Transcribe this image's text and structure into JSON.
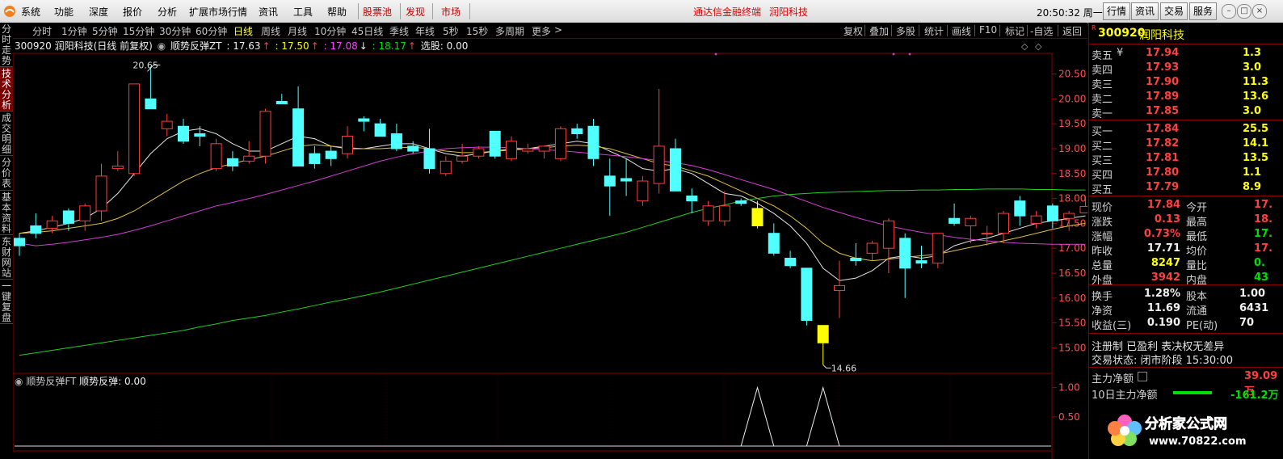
{
  "menu": {
    "items": [
      "系统",
      "功能",
      "深度",
      "报价",
      "分析",
      "扩展市场行情",
      "资讯",
      "工具",
      "帮助"
    ],
    "red_items": [
      "股票池",
      "发现",
      "市场"
    ],
    "center_text": "通达信金融终端",
    "center_stock": "润阳科技",
    "time": "20:50:32 周一",
    "right_buttons": [
      "行情",
      "资讯",
      "交易",
      "服务"
    ]
  },
  "left_tabs": [
    "分时走势",
    "技术分析",
    "成交明细",
    "分价表",
    "基本资料",
    "东财网站",
    "一键复盘"
  ],
  "periods": [
    "分时",
    "1分钟",
    "5分钟",
    "15分钟",
    "30分钟",
    "60分钟",
    "日线",
    "周线",
    "月线",
    "10分钟",
    "45日线",
    "季线",
    "年线",
    "5秒",
    "15秒",
    "多周期",
    "更多"
  ],
  "active_period": "日线",
  "right_tools": [
    "复权",
    "叠加",
    "多股",
    "统计",
    "画线",
    "F10",
    "标记",
    "-自选",
    "返回"
  ],
  "info": {
    "code_name": "300920 润阳科技(日线 前复权)",
    "indicator": "顺势反弹ZT",
    "v1": ": 17.63",
    "a1": "↑",
    "v2": ": 17.50",
    "a2": "↑",
    "v3": ": 17.08",
    "a3": "↓",
    "v4": ": 18.17",
    "a4": "↑",
    "pick": "选股: 0.00"
  },
  "sub": {
    "label": "顺势反弹FT",
    "value": "顺势反弹: 0.00"
  },
  "chart_data": {
    "type": "candlestick",
    "y_ticks": [
      "20.50",
      "20.00",
      "19.50",
      "19.00",
      "18.50",
      "18.00",
      "17.50",
      "17.00",
      "16.50",
      "16.00",
      "15.50",
      "15.00"
    ],
    "y_range": [
      14.52,
      20.72
    ],
    "annotations": {
      "high": "20.65",
      "low": "14.66"
    },
    "candles": [
      [
        17.2,
        17.3,
        16.85,
        17.05
      ],
      [
        17.45,
        17.7,
        17.2,
        17.3
      ],
      [
        17.4,
        17.65,
        17.3,
        17.55
      ],
      [
        17.75,
        17.8,
        17.35,
        17.5
      ],
      [
        17.55,
        17.9,
        17.35,
        17.85
      ],
      [
        17.75,
        18.7,
        17.55,
        18.45
      ],
      [
        18.6,
        18.95,
        18.55,
        18.65
      ],
      [
        18.5,
        20.3,
        18.45,
        20.3
      ],
      [
        20.0,
        20.65,
        19.85,
        19.8
      ],
      [
        19.4,
        19.7,
        19.25,
        19.55
      ],
      [
        19.45,
        19.6,
        19.1,
        19.15
      ],
      [
        19.3,
        19.45,
        19.05,
        19.25
      ],
      [
        18.6,
        19.2,
        18.55,
        19.1
      ],
      [
        18.8,
        18.95,
        18.55,
        18.65
      ],
      [
        18.75,
        19.15,
        18.7,
        18.85
      ],
      [
        18.85,
        19.8,
        18.7,
        19.75
      ],
      [
        19.95,
        20.1,
        19.9,
        19.9
      ],
      [
        19.8,
        20.25,
        19.65,
        18.65
      ],
      [
        18.9,
        19.05,
        18.6,
        18.7
      ],
      [
        18.95,
        19.05,
        18.65,
        18.8
      ],
      [
        18.9,
        19.45,
        18.8,
        19.25
      ],
      [
        19.6,
        19.65,
        19.35,
        19.55
      ],
      [
        19.5,
        19.6,
        19.3,
        19.25
      ],
      [
        19.3,
        19.5,
        18.95,
        19.0
      ],
      [
        19.05,
        19.15,
        18.9,
        18.95
      ],
      [
        19.0,
        19.4,
        18.5,
        18.6
      ],
      [
        18.5,
        18.85,
        18.45,
        18.75
      ],
      [
        18.75,
        19.1,
        18.7,
        18.85
      ],
      [
        18.85,
        19.05,
        18.8,
        19.0
      ],
      [
        19.35,
        19.35,
        18.8,
        18.85
      ],
      [
        18.8,
        19.25,
        18.75,
        19.15
      ],
      [
        18.95,
        19.1,
        18.9,
        19.0
      ],
      [
        18.95,
        19.05,
        18.8,
        19.05
      ],
      [
        18.8,
        19.45,
        18.75,
        19.4
      ],
      [
        19.4,
        19.5,
        19.2,
        19.3
      ],
      [
        19.45,
        19.6,
        18.65,
        18.8
      ],
      [
        18.45,
        18.8,
        17.65,
        18.25
      ],
      [
        18.4,
        18.8,
        18.05,
        18.35
      ],
      [
        17.95,
        18.45,
        17.85,
        18.35
      ],
      [
        18.3,
        20.2,
        18.1,
        19.05
      ],
      [
        19.0,
        19.2,
        18.15,
        18.15
      ],
      [
        18.05,
        18.2,
        17.7,
        17.95
      ],
      [
        17.55,
        17.95,
        17.45,
        17.85
      ],
      [
        17.55,
        18.15,
        17.45,
        17.85
      ],
      [
        17.95,
        18.0,
        17.85,
        17.9
      ],
      [
        17.8,
        17.95,
        17.4,
        17.45
      ],
      [
        17.3,
        17.5,
        16.85,
        16.9
      ],
      [
        16.8,
        16.95,
        16.6,
        16.65
      ],
      [
        16.6,
        16.6,
        15.45,
        15.55
      ],
      [
        15.1,
        15.45,
        14.66,
        15.45
      ],
      [
        16.15,
        16.75,
        15.6,
        16.25
      ],
      [
        16.8,
        17.1,
        16.65,
        16.75
      ],
      [
        16.9,
        17.15,
        16.75,
        17.1
      ],
      [
        17.0,
        17.6,
        16.5,
        17.55
      ],
      [
        17.2,
        17.3,
        16.0,
        16.6
      ],
      [
        16.75,
        17.05,
        16.6,
        16.7
      ],
      [
        16.7,
        17.3,
        16.6,
        17.3
      ],
      [
        17.6,
        17.9,
        17.45,
        17.5
      ],
      [
        17.45,
        17.65,
        17.1,
        17.6
      ],
      [
        17.3,
        17.45,
        17.05,
        17.3
      ],
      [
        17.3,
        17.75,
        17.1,
        17.7
      ],
      [
        17.95,
        18.05,
        17.45,
        17.65
      ],
      [
        17.5,
        17.75,
        17.4,
        17.65
      ],
      [
        17.85,
        17.9,
        17.4,
        17.55
      ],
      [
        17.6,
        17.75,
        17.35,
        17.7
      ],
      [
        17.71,
        18.05,
        17.71,
        17.84
      ]
    ],
    "signals_candle_index": [
      45,
      49
    ],
    "ma_lines": {
      "ma_short": [
        17.3,
        17.35,
        17.42,
        17.5,
        17.6,
        17.8,
        18.1,
        18.5,
        18.9,
        19.2,
        19.35,
        19.4,
        19.3,
        19.1,
        18.95,
        18.95,
        19.1,
        19.25,
        19.2,
        19.05,
        19.0,
        19.0,
        19.05,
        19.1,
        19.1,
        19.0,
        18.9,
        18.85,
        18.9,
        18.95,
        19.0,
        19.0,
        19.05,
        19.1,
        19.15,
        19.1,
        18.95,
        18.8,
        18.6,
        18.55,
        18.6,
        18.5,
        18.3,
        18.1,
        18.05,
        17.9,
        17.7,
        17.45,
        17.1,
        16.6,
        16.35,
        16.4,
        16.55,
        16.8,
        16.85,
        16.8,
        16.85,
        17.05,
        17.15,
        17.2,
        17.3,
        17.4,
        17.5,
        17.55,
        17.6,
        17.65
      ],
      "ma_mid": [
        17.3,
        17.32,
        17.35,
        17.4,
        17.45,
        17.5,
        17.6,
        17.75,
        17.95,
        18.15,
        18.35,
        18.5,
        18.62,
        18.7,
        18.78,
        18.85,
        18.95,
        19.05,
        19.08,
        19.05,
        19.02,
        19.0,
        19.0,
        19.02,
        19.03,
        19.0,
        18.95,
        18.92,
        18.92,
        18.95,
        18.97,
        19.0,
        19.02,
        19.05,
        19.07,
        19.05,
        19.0,
        18.9,
        18.8,
        18.7,
        18.65,
        18.55,
        18.45,
        18.3,
        18.15,
        18.0,
        17.85,
        17.65,
        17.4,
        17.1,
        16.9,
        16.8,
        16.75,
        16.78,
        16.82,
        16.85,
        16.88,
        16.95,
        17.02,
        17.08,
        17.15,
        17.22,
        17.3,
        17.38,
        17.45,
        17.5
      ],
      "ma_long": [
        17.1,
        17.05,
        17.08,
        17.12,
        17.17,
        17.22,
        17.28,
        17.36,
        17.45,
        17.55,
        17.65,
        17.75,
        17.85,
        17.92,
        18.0,
        18.08,
        18.17,
        18.26,
        18.35,
        18.45,
        18.55,
        18.65,
        18.75,
        18.83,
        18.9,
        18.95,
        19.0,
        19.02,
        19.03,
        19.03,
        19.02,
        19.0,
        18.98,
        18.96,
        18.93,
        18.9,
        18.87,
        18.84,
        18.8,
        18.76,
        18.72,
        18.66,
        18.58,
        18.48,
        18.38,
        18.28,
        18.18,
        18.06,
        17.94,
        17.82,
        17.72,
        17.62,
        17.53,
        17.45,
        17.38,
        17.32,
        17.27,
        17.22,
        17.18,
        17.15,
        17.12,
        17.1,
        17.09,
        17.08,
        17.08,
        17.08
      ],
      "ma_green": [
        14.85,
        14.9,
        14.95,
        15.0,
        15.05,
        15.1,
        15.15,
        15.2,
        15.25,
        15.3,
        15.35,
        15.42,
        15.48,
        15.55,
        15.6,
        15.65,
        15.72,
        15.78,
        15.85,
        15.92,
        15.98,
        16.05,
        16.12,
        16.2,
        16.28,
        16.36,
        16.44,
        16.52,
        16.6,
        16.68,
        16.76,
        16.84,
        16.92,
        17.0,
        17.08,
        17.16,
        17.24,
        17.32,
        17.42,
        17.52,
        17.62,
        17.72,
        17.8,
        17.87,
        17.95,
        18.0,
        18.05,
        18.08,
        18.1,
        18.12,
        18.13,
        18.14,
        18.15,
        18.16,
        18.16,
        18.17,
        18.17,
        18.18,
        18.18,
        18.19,
        18.19,
        18.19,
        18.18,
        18.18,
        18.17,
        18.17
      ]
    }
  },
  "quote": {
    "code": "300920",
    "name": "润阳科技",
    "asks": [
      {
        "label": "卖五",
        "mark": "¥",
        "price": "17.94",
        "vol": "1.3"
      },
      {
        "label": "卖四",
        "mark": "",
        "price": "17.93",
        "vol": "3.0"
      },
      {
        "label": "卖三",
        "mark": "",
        "price": "17.90",
        "vol": "11.3"
      },
      {
        "label": "卖二",
        "mark": "",
        "price": "17.89",
        "vol": "13.6"
      },
      {
        "label": "卖一",
        "mark": "",
        "price": "17.85",
        "vol": "3.0"
      }
    ],
    "bids": [
      {
        "label": "买一",
        "price": "17.84",
        "vol": "25.5"
      },
      {
        "label": "买二",
        "price": "17.82",
        "vol": "14.1"
      },
      {
        "label": "买三",
        "price": "17.81",
        "vol": "13.5"
      },
      {
        "label": "买四",
        "price": "17.80",
        "vol": "1.1"
      },
      {
        "label": "买五",
        "price": "17.79",
        "vol": "8.9"
      }
    ],
    "stats": [
      {
        "l1": "现价",
        "v1": "17.84",
        "c1": "red",
        "l2": "今开",
        "v2": "17.",
        "c2": "red"
      },
      {
        "l1": "涨跌",
        "v1": "0.13",
        "c1": "red",
        "l2": "最高",
        "v2": "18.",
        "c2": "red"
      },
      {
        "l1": "涨幅",
        "v1": "0.73%",
        "c1": "red",
        "l2": "最低",
        "v2": "17.",
        "c2": "green"
      },
      {
        "l1": "昨收",
        "v1": "17.71",
        "c1": "white",
        "l2": "均价",
        "v2": "17.",
        "c2": "red"
      },
      {
        "l1": "总量",
        "v1": "8247",
        "c1": "yellow",
        "l2": "量比",
        "v2": "0.",
        "c2": "green"
      },
      {
        "l1": "外盘",
        "v1": "3942",
        "c1": "red",
        "l2": "内盘",
        "v2": "43",
        "c2": "green"
      }
    ],
    "stats2": [
      {
        "l1": "换手",
        "v1": "1.28%",
        "l2": "股本",
        "v2": "1.00"
      },
      {
        "l1": "净资",
        "v1": "11.69",
        "l2": "流通",
        "v2": "6431"
      },
      {
        "l1": "收益(三)",
        "v1": "0.190",
        "l2": "PE(动)",
        "v2": "70"
      }
    ],
    "reg": "注册制 已盈利 表决权无差异",
    "status": "交易状态: 闭市阶段 15:30:00",
    "flow1_label": "主力净额",
    "flow1_value": "39.09万",
    "flow2_label": "10日主力净额",
    "flow2_value": "-161.2万",
    "logo_text": "分析家公式网",
    "logo_url": "www.70822.com",
    "r_mark": "R"
  },
  "sub_chart": {
    "y_ticks": [
      "1.00",
      "0.50"
    ],
    "signal_index": [
      45,
      49
    ]
  }
}
